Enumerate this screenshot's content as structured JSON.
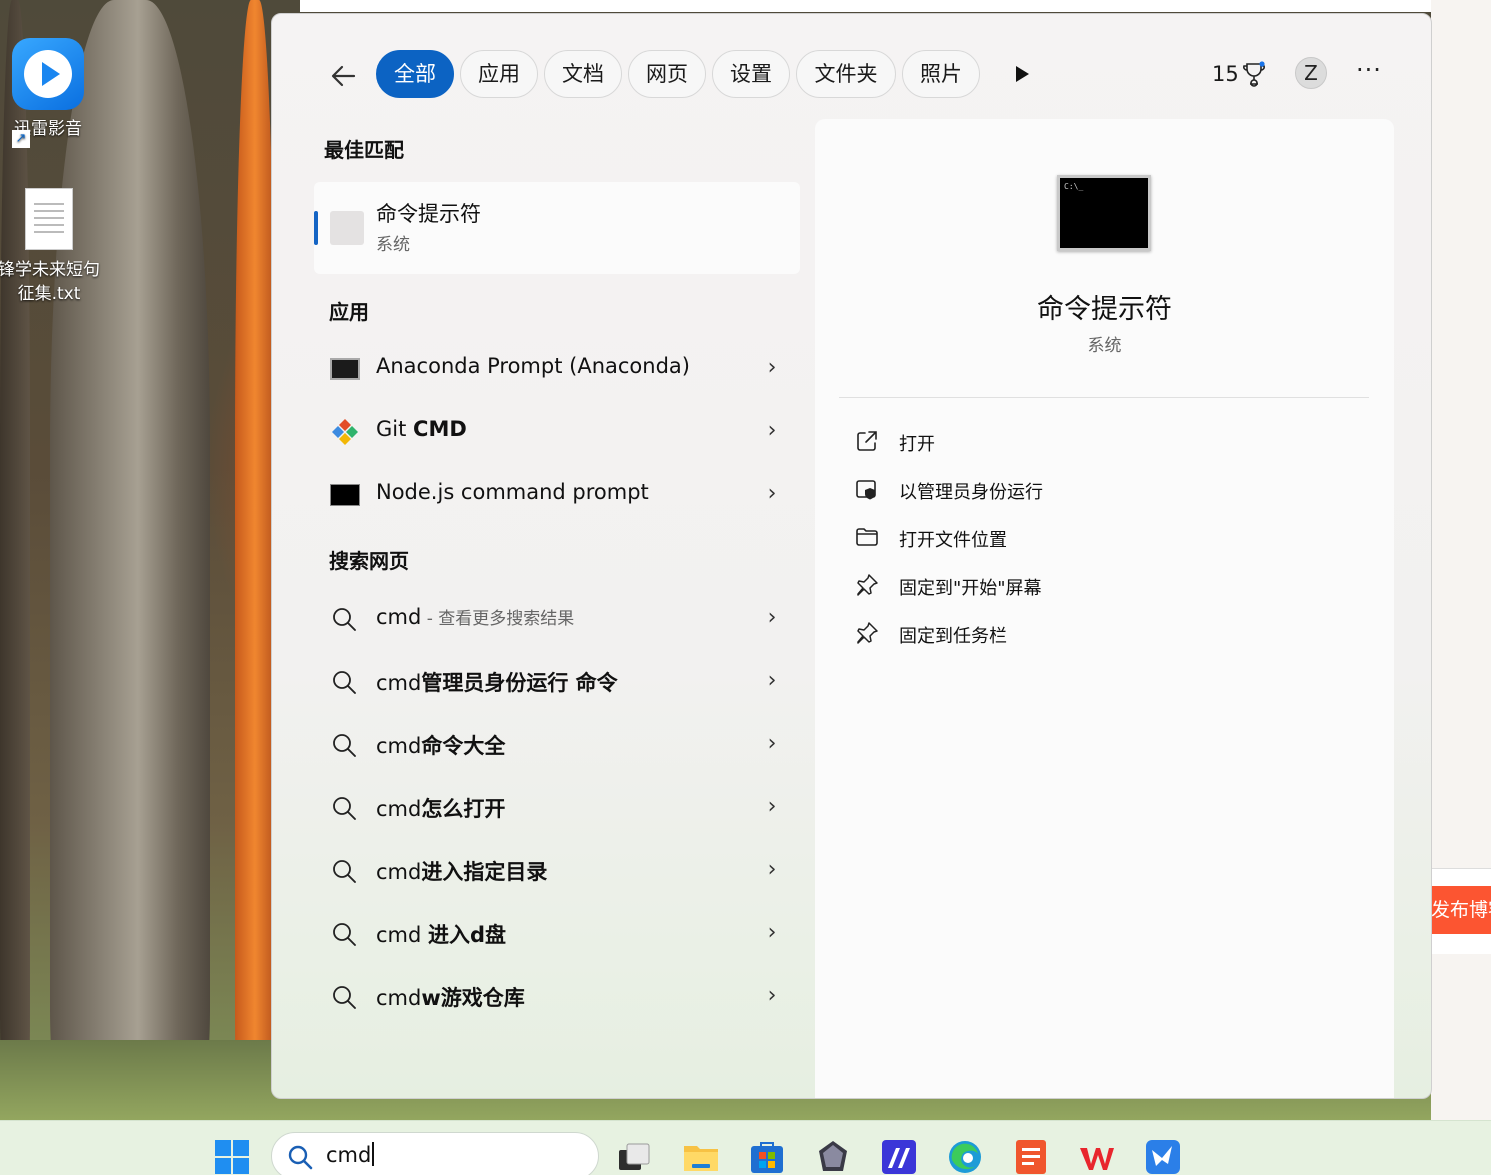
{
  "desktop": {
    "icons": [
      {
        "label": "迅雷影音"
      },
      {
        "label_line1": "锋学未来短句",
        "label_line2": "征集.txt"
      }
    ],
    "right_page_button": "发布博客"
  },
  "search": {
    "filters": [
      "全部",
      "应用",
      "文档",
      "网页",
      "设置",
      "文件夹",
      "照片"
    ],
    "active_filter": "全部",
    "points": "15",
    "avatar_letter": "Z",
    "more": "···",
    "best_match_title": "最佳匹配",
    "best_match": {
      "name": "命令提示符",
      "type": "系统"
    },
    "apps_title": "应用",
    "apps": [
      {
        "name": "Anaconda Prompt (Anaconda)",
        "icon": "terminal-icon"
      },
      {
        "name_plain": "Git ",
        "name_bold": "CMD",
        "icon": "git-icon"
      },
      {
        "name": "Node.js command prompt",
        "icon": "terminal-icon"
      }
    ],
    "web_title": "搜索网页",
    "web_results": [
      {
        "plain": "cmd",
        "bold": "",
        "hint": " - 查看更多搜索结果"
      },
      {
        "plain": "cmd",
        "bold": "管理员身份运行 命令",
        "hint": ""
      },
      {
        "plain": "cmd",
        "bold": "命令大全",
        "hint": ""
      },
      {
        "plain": "cmd",
        "bold": "怎么打开",
        "hint": ""
      },
      {
        "plain": "cmd",
        "bold": "进入指定目录",
        "hint": ""
      },
      {
        "plain": "cmd ",
        "bold": "进入d盘",
        "hint": ""
      },
      {
        "plain": "cmd",
        "bold": "w游戏仓库",
        "hint": ""
      }
    ],
    "detail": {
      "name": "命令提示符",
      "type": "系统",
      "actions": [
        {
          "label": "打开",
          "icon": "open-external-icon"
        },
        {
          "label": "以管理员身份运行",
          "icon": "admin-shield-icon"
        },
        {
          "label": "打开文件位置",
          "icon": "folder-icon"
        },
        {
          "label": "固定到\"开始\"屏幕",
          "icon": "pin-icon"
        },
        {
          "label": "固定到任务栏",
          "icon": "pin-icon"
        }
      ]
    }
  },
  "taskbar": {
    "search_value": "cmd",
    "apps": [
      "task-view-icon",
      "file-explorer-icon",
      "microsoft-store-icon",
      "obsidian-icon",
      "ide-icon",
      "edge-icon",
      "wps-presentation-icon",
      "wps-office-icon",
      "feishu-icon"
    ]
  },
  "colors": {
    "accent": "#0c63c3",
    "publish": "#fc5531",
    "start": "#1f8ef1"
  }
}
